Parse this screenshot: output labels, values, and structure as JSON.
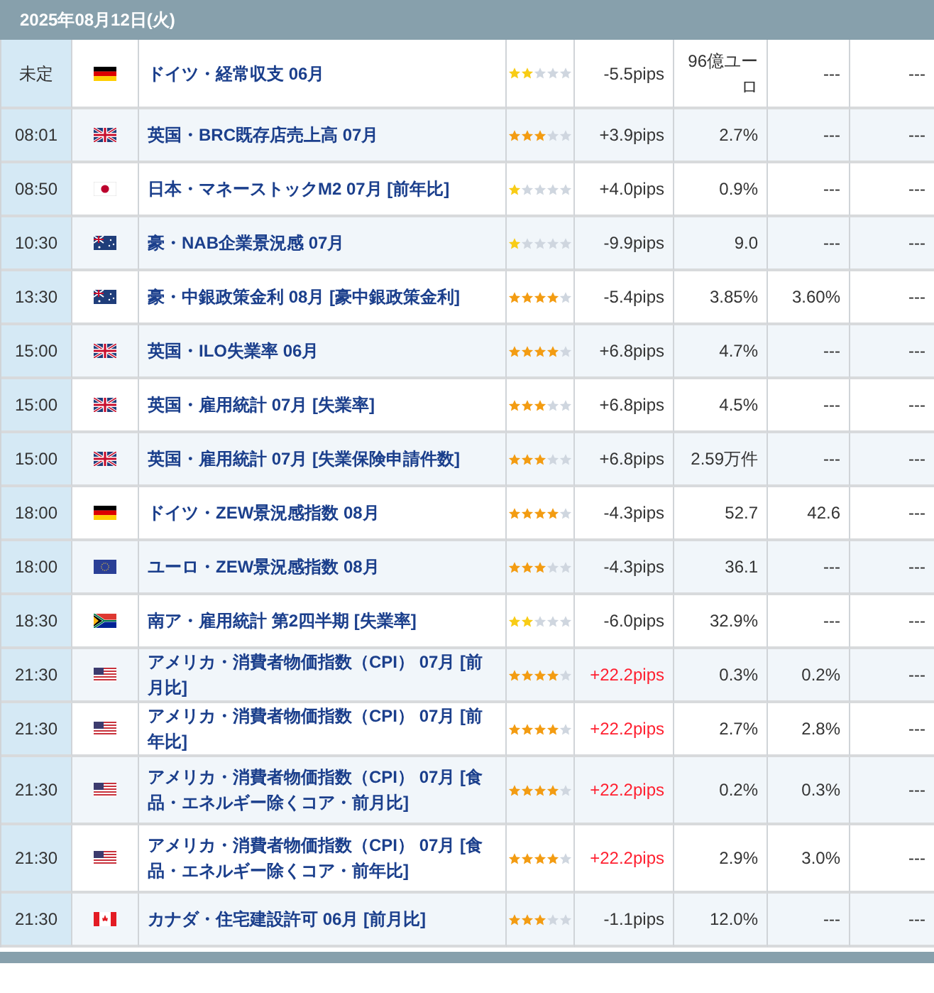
{
  "date_header": "2025年08月12日(火)",
  "rows": [
    {
      "time": "未定",
      "flag": {
        "kind": "de"
      },
      "event": "ドイツ・経常収支 06月",
      "stars": 2,
      "pips": "-5.5pips",
      "alert": false,
      "col_1": "96億ユーロ",
      "col_2": "---",
      "col_3": "---"
    },
    {
      "time": "08:01",
      "flag": {
        "kind": "gb"
      },
      "event": "英国・BRC既存店売上高 07月",
      "stars": 3,
      "pips": "+3.9pips",
      "alert": false,
      "col_1": "2.7%",
      "col_2": "---",
      "col_3": "---"
    },
    {
      "time": "08:50",
      "flag": {
        "kind": "jp"
      },
      "event": "日本・マネーストックM2 07月 [前年比]",
      "stars": 1,
      "pips": "+4.0pips",
      "alert": false,
      "col_1": "0.9%",
      "col_2": "---",
      "col_3": "---"
    },
    {
      "time": "10:30",
      "flag": {
        "kind": "au"
      },
      "event": "豪・NAB企業景況感 07月",
      "stars": 1,
      "pips": "-9.9pips",
      "alert": false,
      "col_1": "9.0",
      "col_2": "---",
      "col_3": "---"
    },
    {
      "time": "13:30",
      "flag": {
        "kind": "au"
      },
      "event": "豪・中銀政策金利 08月 [豪中銀政策金利]",
      "stars": 4,
      "pips": "-5.4pips",
      "alert": false,
      "col_1": "3.85%",
      "col_2": "3.60%",
      "col_3": "---"
    },
    {
      "time": "15:00",
      "flag": {
        "kind": "gb"
      },
      "event": "英国・ILO失業率 06月",
      "stars": 4,
      "pips": "+6.8pips",
      "alert": false,
      "col_1": "4.7%",
      "col_2": "---",
      "col_3": "---"
    },
    {
      "time": "15:00",
      "flag": {
        "kind": "gb"
      },
      "event": "英国・雇用統計 07月 [失業率]",
      "stars": 3,
      "pips": "+6.8pips",
      "alert": false,
      "col_1": "4.5%",
      "col_2": "---",
      "col_3": "---"
    },
    {
      "time": "15:00",
      "flag": {
        "kind": "gb"
      },
      "event": "英国・雇用統計 07月 [失業保険申請件数]",
      "stars": 3,
      "pips": "+6.8pips",
      "alert": false,
      "col_1": "2.59万件",
      "col_2": "---",
      "col_3": "---"
    },
    {
      "time": "18:00",
      "flag": {
        "kind": "de"
      },
      "event": "ドイツ・ZEW景況感指数 08月",
      "stars": 4,
      "pips": "-4.3pips",
      "alert": false,
      "col_1": "52.7",
      "col_2": "42.6",
      "col_3": "---"
    },
    {
      "time": "18:00",
      "flag": {
        "kind": "eu"
      },
      "event": "ユーロ・ZEW景況感指数 08月",
      "stars": 3,
      "pips": "-4.3pips",
      "alert": false,
      "col_1": "36.1",
      "col_2": "---",
      "col_3": "---"
    },
    {
      "time": "18:30",
      "flag": {
        "kind": "za"
      },
      "event": "南ア・雇用統計 第2四半期 [失業率]",
      "stars": 2,
      "pips": "-6.0pips",
      "alert": false,
      "col_1": "32.9%",
      "col_2": "---",
      "col_3": "---"
    },
    {
      "time": "21:30",
      "flag": {
        "kind": "us"
      },
      "event": "アメリカ・消費者物価指数（CPI） 07月 [前月比]",
      "stars": 4,
      "pips": "+22.2pips",
      "alert": true,
      "col_1": "0.3%",
      "col_2": "0.2%",
      "col_3": "---"
    },
    {
      "time": "21:30",
      "flag": {
        "kind": "us"
      },
      "event": "アメリカ・消費者物価指数（CPI） 07月 [前年比]",
      "stars": 4,
      "pips": "+22.2pips",
      "alert": true,
      "col_1": "2.7%",
      "col_2": "2.8%",
      "col_3": "---"
    },
    {
      "time": "21:30",
      "flag": {
        "kind": "us"
      },
      "event": "アメリカ・消費者物価指数（CPI） 07月 [食品・エネルギー除くコア・前月比]",
      "stars": 4,
      "pips": "+22.2pips",
      "alert": true,
      "col_1": "0.2%",
      "col_2": "0.3%",
      "col_3": "---"
    },
    {
      "time": "21:30",
      "flag": {
        "kind": "us"
      },
      "event": "アメリカ・消費者物価指数（CPI） 07月 [食品・エネルギー除くコア・前年比]",
      "stars": 4,
      "pips": "+22.2pips",
      "alert": true,
      "col_1": "2.9%",
      "col_2": "3.0%",
      "col_3": "---"
    },
    {
      "time": "21:30",
      "flag": {
        "kind": "ca"
      },
      "event": "カナダ・住宅建設許可 06月 [前月比]",
      "stars": 3,
      "pips": "-1.1pips",
      "alert": false,
      "col_1": "12.0%",
      "col_2": "---",
      "col_3": "---"
    }
  ]
}
